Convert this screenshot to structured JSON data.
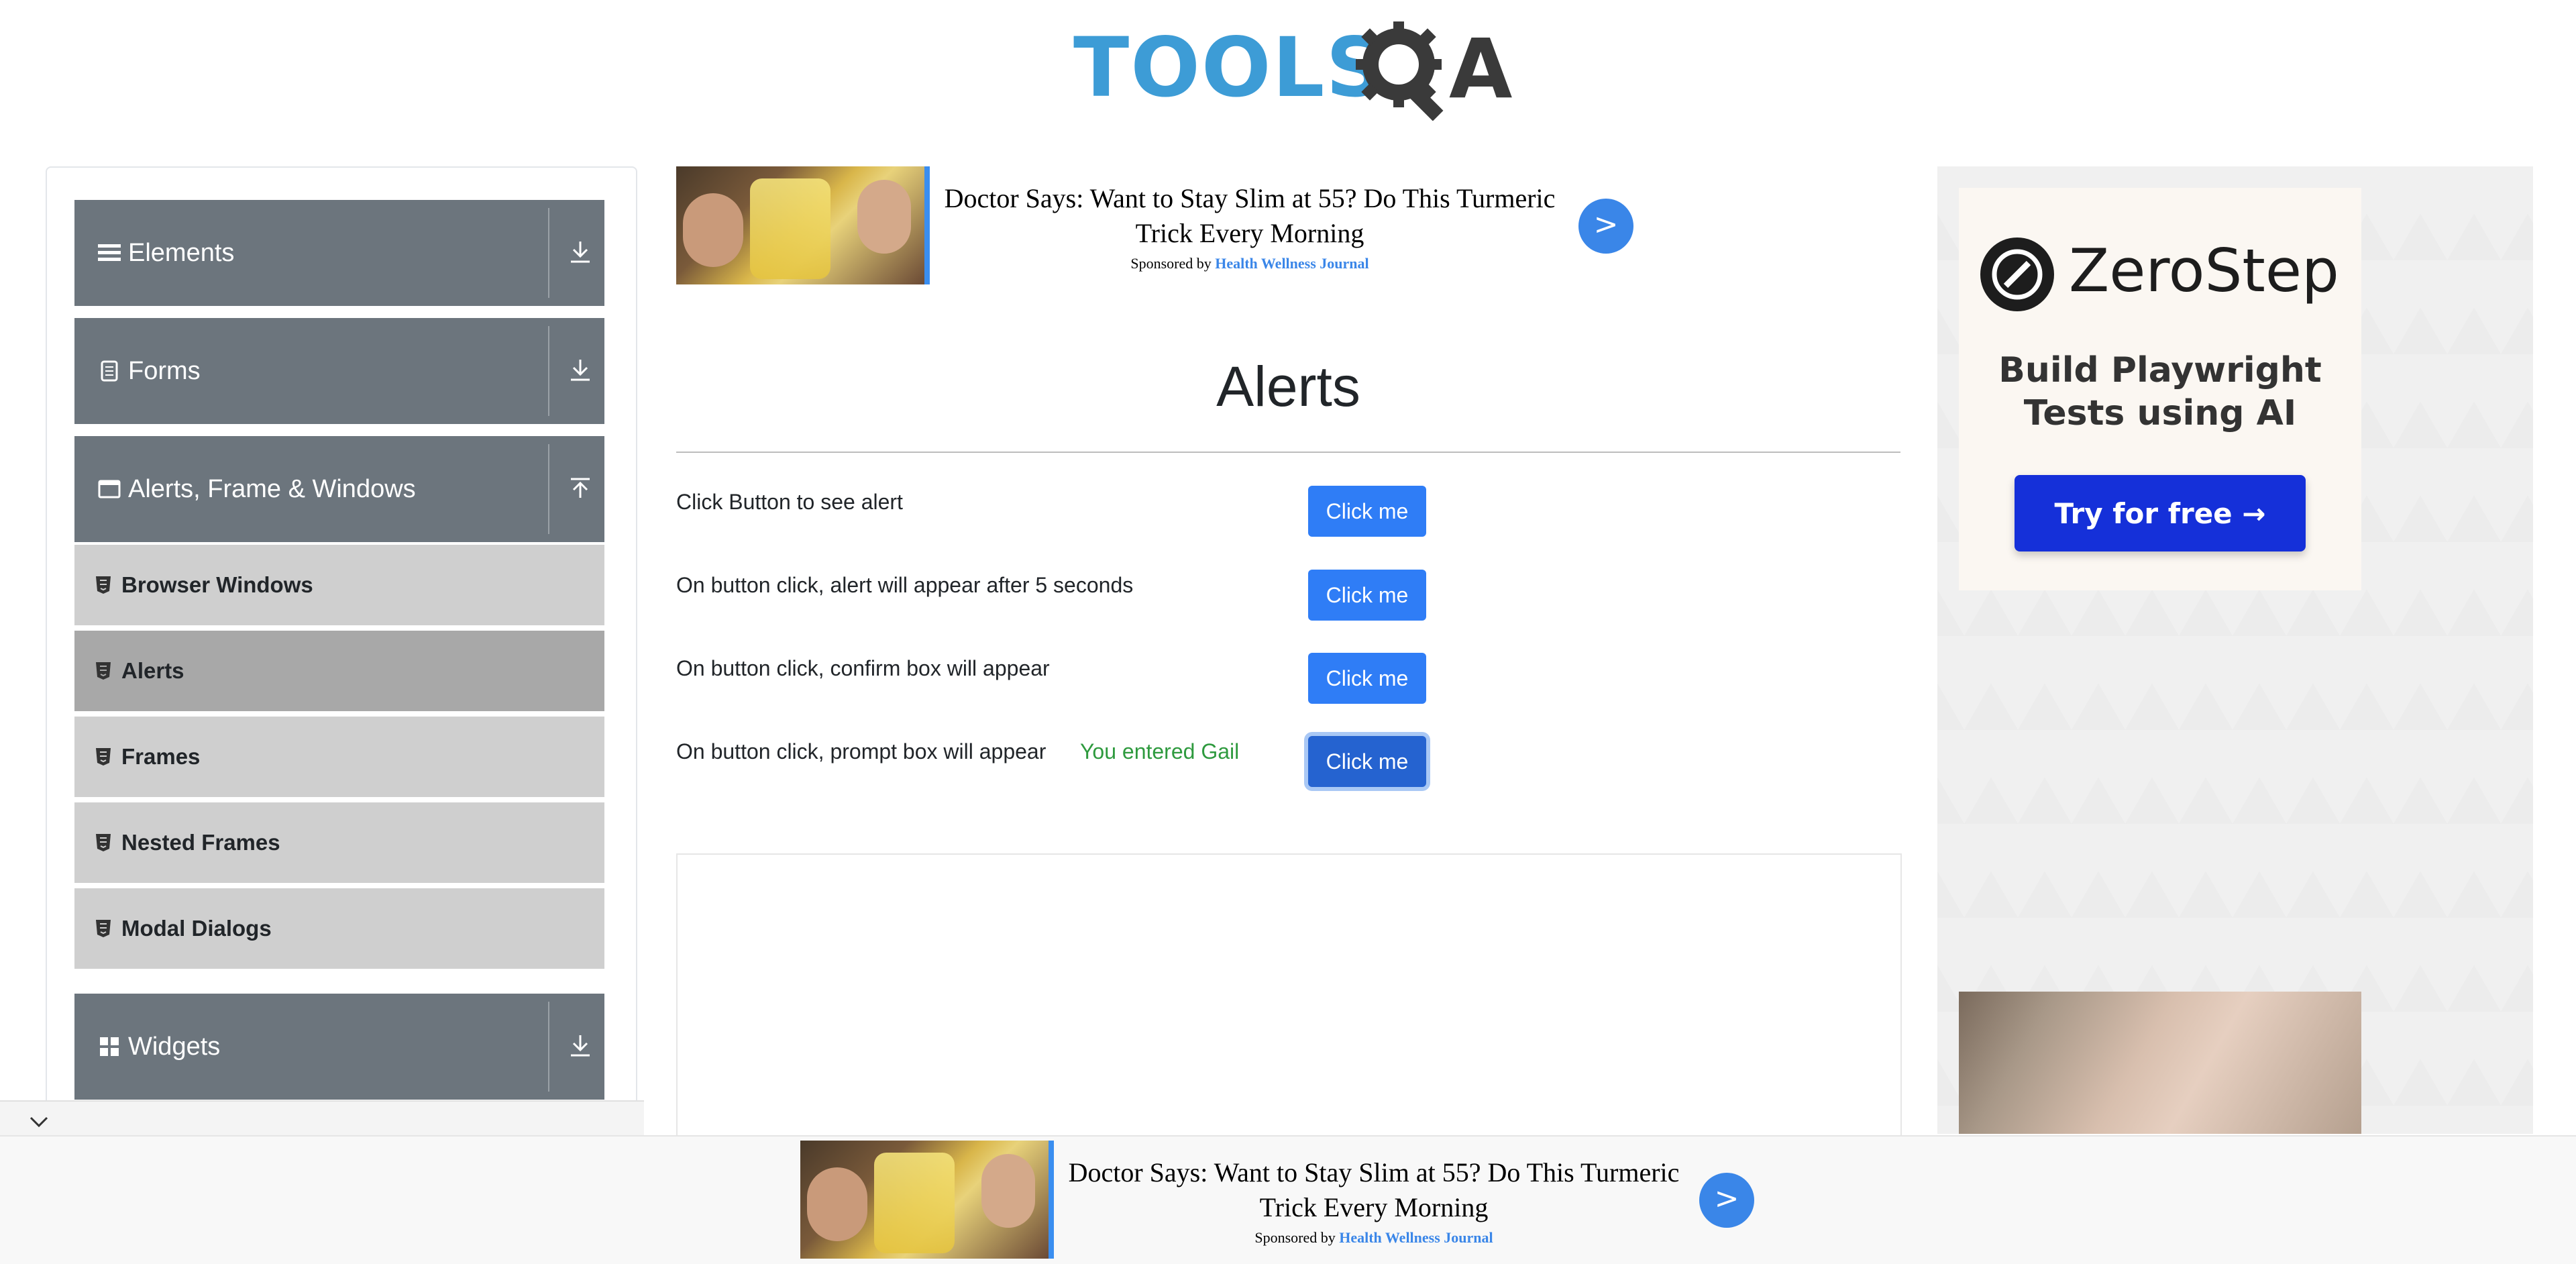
{
  "header": {
    "logo_text_left": "TOOLS",
    "logo_text_right": "A"
  },
  "sidebar": {
    "groups": [
      {
        "label": "Elements",
        "icon": "hamburger-icon",
        "arrow": "download-icon"
      },
      {
        "label": "Forms",
        "icon": "document-icon",
        "arrow": "download-icon"
      },
      {
        "label": "Alerts, Frame & Windows",
        "icon": "window-icon",
        "arrow": "upload-icon"
      },
      {
        "label": "Widgets",
        "icon": "grid-icon",
        "arrow": "download-icon"
      }
    ],
    "items": [
      {
        "label": "Browser Windows",
        "active": false
      },
      {
        "label": "Alerts",
        "active": true
      },
      {
        "label": "Frames",
        "active": false
      },
      {
        "label": "Nested Frames",
        "active": false
      },
      {
        "label": "Modal Dialogs",
        "active": false
      }
    ]
  },
  "ad_top": {
    "headline": "Doctor Says: Want to Stay Slim at 55? Do This Turmeric Trick Every Morning",
    "sponsored_prefix": "Sponsored by",
    "sponsor": "Health Wellness Journal",
    "go": ">"
  },
  "main": {
    "title": "Alerts",
    "rows": [
      {
        "text": "Click Button to see alert",
        "button": "Click me"
      },
      {
        "text": "On button click, alert will appear after 5 seconds",
        "button": "Click me"
      },
      {
        "text": "On button click, confirm box will appear",
        "button": "Click me"
      },
      {
        "text": "On button click, prompt box will appear",
        "button": "Click me",
        "result": "You entered Gail"
      }
    ]
  },
  "right_ad": {
    "brand": "ZeroStep",
    "tagline_line1": "Build Playwright",
    "tagline_line2": "Tests using AI",
    "cta": "Try for free →"
  },
  "ad_bottom": {
    "headline": "Doctor Says: Want to Stay Slim at 55? Do This Turmeric Trick Every Morning",
    "sponsored_prefix": "Sponsored by",
    "sponsor": "Health Wellness Journal",
    "go": ">"
  },
  "colors": {
    "sidebar_header": "#6c757d",
    "sidebar_item": "#cfcfcf",
    "sidebar_item_active": "#a8a8a8",
    "primary_button": "#2f7df6",
    "success_text": "#2e9a3e",
    "zerostep_button": "#1530d9",
    "logo_blue": "#3d9cd6"
  }
}
